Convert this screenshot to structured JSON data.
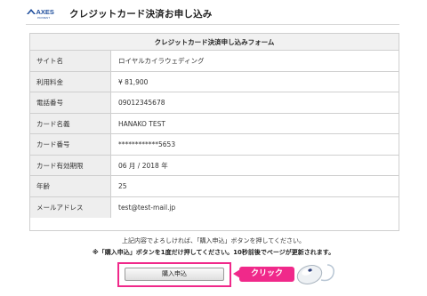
{
  "header": {
    "logo_text": "AXES",
    "logo_subtext": "PAYMENT",
    "title": "クレジットカード決済お申し込み"
  },
  "form": {
    "title": "クレジットカード決済申し込みフォーム",
    "rows": [
      {
        "label": "サイト名",
        "value": "ロイヤルカイラウェディング"
      },
      {
        "label": "利用料金",
        "value": "¥ 81,900"
      },
      {
        "label": "電話番号",
        "value": "09012345678"
      },
      {
        "label": "カード名義",
        "value": "HANAKO TEST"
      },
      {
        "label": "カード番号",
        "value": "************5653"
      },
      {
        "label": "カード有効期限",
        "value": "06 月 / 2018 年"
      },
      {
        "label": "年齢",
        "value": "25"
      },
      {
        "label": "メールアドレス",
        "value": "test@test-mail.jp"
      }
    ]
  },
  "notice": {
    "line1": "上記内容でよろしければ、「購入申込」ボタンを押してください。",
    "line2": "※「購入申込」ボタンを1度だけ押してください。10秒前後でページが更新されます。"
  },
  "purchase_button_label": "購入申込",
  "callout_label": "クリック",
  "colors": {
    "highlight": "#f0298a",
    "logo_blue": "#1f4e9c"
  },
  "icons": {
    "logo": "axes-logo",
    "mouse": "computer-mouse-icon"
  }
}
